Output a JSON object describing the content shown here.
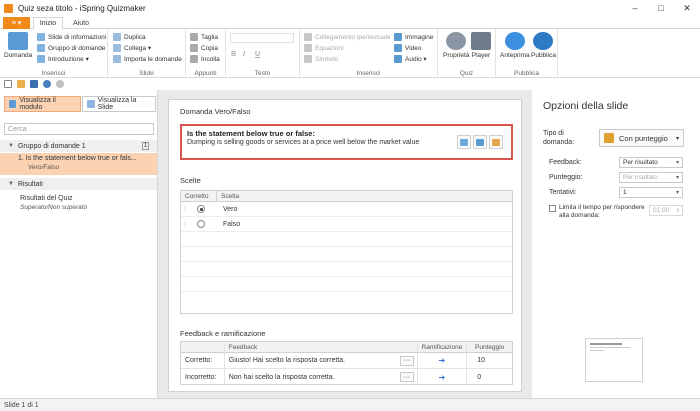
{
  "window": {
    "title": "Quiz seza titolo - iSpring Quizmaker",
    "minimize": "–",
    "maximize": "□",
    "close": "✕"
  },
  "tabs": {
    "file": "≡ ▾",
    "items": [
      "Inizio",
      "Aiuto"
    ]
  },
  "ribbon": {
    "inserisci": {
      "label": "Inserisci",
      "domanda": "Domanda",
      "slide_info": "Slide di informazioni",
      "gruppo": "Gruppo di domande",
      "introduzione": "Introduzione ▾"
    },
    "slide": {
      "label": "Slide",
      "duplica": "Duplica",
      "collega": "Collega ▾",
      "importa": "Importa le domande"
    },
    "appunti": {
      "label": "Appunti",
      "taglia": "Taglia",
      "copia": "Copia",
      "incolla": "Incolla"
    },
    "testo": {
      "label": "Testo",
      "bold": "B",
      "italic": "I",
      "underline": "U"
    },
    "inserisci2": {
      "label": "Inserisci",
      "collegamento": "Collegamento ipertestuale",
      "equazioni": "Equazioni",
      "simbolo": "Simbolo",
      "immagine": "Immagine",
      "video": "Video",
      "audio": "Audio ▾"
    },
    "quiz": {
      "label": "Quiz",
      "proprieta": "Proprietà",
      "player": "Player"
    },
    "pubblica": {
      "label": "Pubblica",
      "anteprima": "Anteprima",
      "pubblica": "Pubblica"
    }
  },
  "left": {
    "view_tabs": [
      "Visualizza il modulo",
      "Visualizza la Slide"
    ],
    "search_placeholder": "Cerca",
    "group": {
      "name": "Gruppo di domande 1",
      "count": "1"
    },
    "selected": {
      "title": "1. Is the statement below true or fals...",
      "type": "Vero/Falso"
    },
    "results_header": "Risultati",
    "results_item": {
      "title": "Risultati del Quiz",
      "sub": "Superato/Non superato"
    }
  },
  "editor": {
    "section_title": "Domanda Vero/Falso",
    "question_title": "Is the statement below true or false:",
    "question_text": "Dumping is selling goods or services at a price well below the market value",
    "choices_title": "Scelte",
    "choices_head": [
      "Corretto",
      "Scelta"
    ],
    "choices": [
      {
        "label": "Vero",
        "correct": true
      },
      {
        "label": "Falso",
        "correct": false
      }
    ],
    "feedback_title": "Feedback e ramificazione",
    "feedback_head": [
      "Feedback",
      "Ramificazione",
      "Punteggio"
    ],
    "feedback_rows": [
      {
        "label": "Corretto:",
        "text": "Giusto! Hai scelto la risposta corretta.",
        "dots": "···",
        "score": "10"
      },
      {
        "label": "Incorretto:",
        "text": "Non hai scelto la risposta corretta.",
        "dots": "···",
        "score": "0"
      }
    ]
  },
  "options": {
    "title": "Opzioni della slide",
    "tipo_label": "Tipo di domanda:",
    "tipo_value": "Con punteggio",
    "feedback_label": "Feedback:",
    "feedback_value": "Per risultato",
    "punteggio_label": "Punteggio:",
    "punteggio_value": "Per risultato",
    "tentativi_label": "Tentativi:",
    "tentativi_value": "1",
    "limit_label": "Limita il tempo per rispondere alla domanda:",
    "time_value": "01:00"
  },
  "status": {
    "text": "Slide 1 di 1"
  }
}
